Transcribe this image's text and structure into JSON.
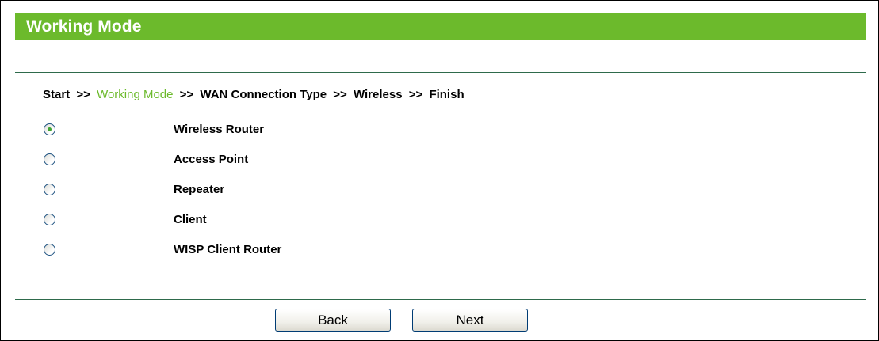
{
  "header": {
    "title": "Working Mode"
  },
  "breadcrumb": {
    "separator": ">>",
    "steps": [
      "Start",
      "Working Mode",
      "WAN Connection Type",
      "Wireless",
      "Finish"
    ],
    "current_index": 1
  },
  "modes": [
    {
      "label": "Wireless Router",
      "checked": true
    },
    {
      "label": "Access Point",
      "checked": false
    },
    {
      "label": "Repeater",
      "checked": false
    },
    {
      "label": "Client",
      "checked": false
    },
    {
      "label": "WISP Client Router",
      "checked": false
    }
  ],
  "buttons": {
    "back_label": "Back",
    "next_label": "Next"
  },
  "colors": {
    "header_bg": "#6cba2c",
    "current_step": "#6cba2c",
    "divider": "#2e6a4b"
  }
}
